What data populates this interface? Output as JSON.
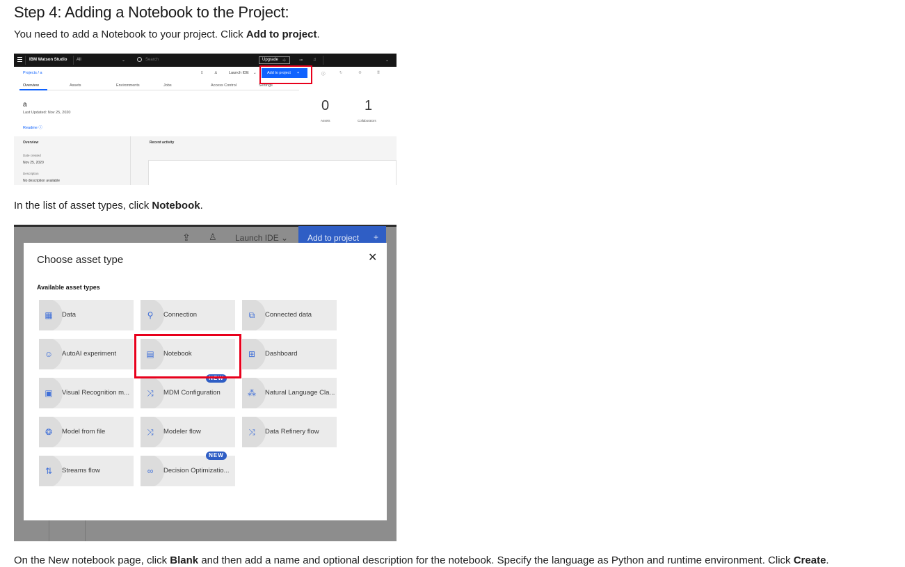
{
  "heading": "Step 4: Adding a Notebook to the Project:",
  "para1": {
    "text": "You need to add a Notebook to your project. Click ",
    "bold": "Add to project",
    "end": "."
  },
  "para2": {
    "text": "In the list of asset types, click ",
    "bold": "Notebook",
    "end": "."
  },
  "para3": {
    "text": "On the New notebook page, click ",
    "bold1": "Blank",
    "mid": " and then add a name and optional description for the notebook. Specify the language as Python and runtime environment. Click ",
    "bold2": "Create",
    "end": "."
  },
  "shot1": {
    "brand": "IBM Watson Studio",
    "scope": "All",
    "search_placeholder": "Search",
    "upgrade": "Upgrade",
    "breadcrumb": "Projects  /  a",
    "launch_ide": "Launch IDE",
    "add_to_project": "Add to project",
    "tabs": [
      "Overview",
      "Assets",
      "Environments",
      "Jobs",
      "Access Control",
      "Settings"
    ],
    "project_name": "a",
    "last_updated": "Last Updated: Nov 25, 2020",
    "readme": "Readme",
    "assets_count": "0",
    "assets_label": "Assets",
    "collaborators_count": "1",
    "collaborators_label": "Collaborators",
    "overview_label": "Overview",
    "recent_activity": "Recent activity",
    "date_created_label": "Date created",
    "date_created": "Nov 25, 2020",
    "description_label": "Description",
    "description": "No description available"
  },
  "shot2": {
    "launch_ide": "Launch IDE",
    "add_to_project": "Add to project",
    "modal_title": "Choose asset type",
    "subtitle": "Available asset types",
    "new_badge": "NEW",
    "tiles": [
      {
        "label": "Data",
        "icon": "data-icon"
      },
      {
        "label": "Connection",
        "icon": "connection-icon"
      },
      {
        "label": "Connected data",
        "icon": "connected-data-icon"
      },
      {
        "label": "AutoAI experiment",
        "icon": "autoai-icon"
      },
      {
        "label": "Notebook",
        "icon": "notebook-icon"
      },
      {
        "label": "Dashboard",
        "icon": "dashboard-icon"
      },
      {
        "label": "Visual Recognition m...",
        "icon": "visual-recognition-icon"
      },
      {
        "label": "MDM Configuration",
        "icon": "mdm-icon"
      },
      {
        "label": "Natural Language Cla...",
        "icon": "nlc-icon"
      },
      {
        "label": "Model from file",
        "icon": "model-file-icon"
      },
      {
        "label": "Modeler flow",
        "icon": "modeler-flow-icon"
      },
      {
        "label": "Data Refinery flow",
        "icon": "data-refinery-icon"
      },
      {
        "label": "Streams flow",
        "icon": "streams-flow-icon"
      },
      {
        "label": "Decision Optimizatio...",
        "icon": "decision-optimization-icon"
      }
    ]
  },
  "colors": {
    "accent_blue": "#0f62fe",
    "highlight_red": "#e8001c",
    "topbar": "#161616"
  }
}
